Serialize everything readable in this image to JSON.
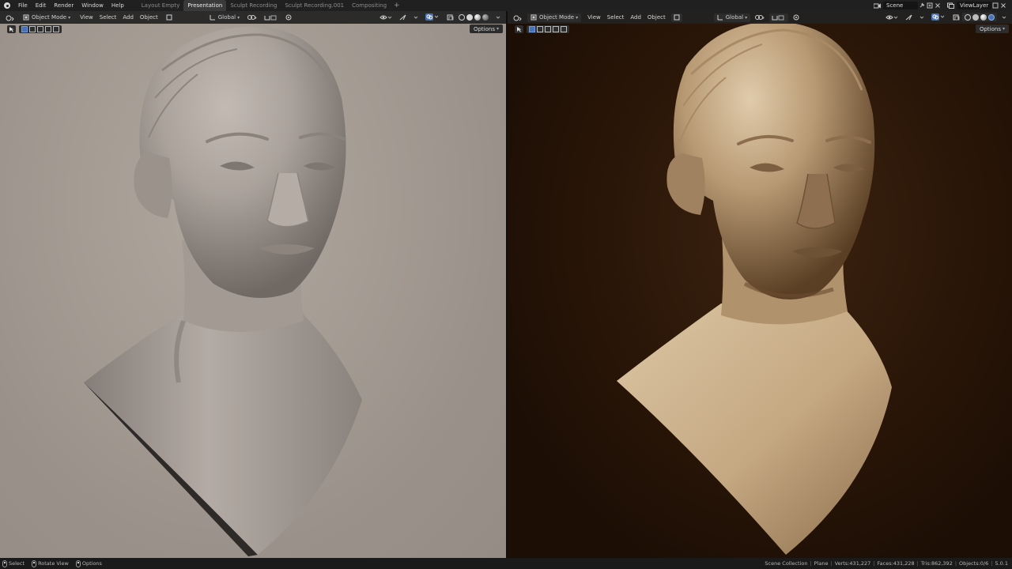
{
  "topbar": {
    "menu": [
      "File",
      "Edit",
      "Render",
      "Window",
      "Help"
    ],
    "workspaces": [
      {
        "label": "Layout Empty",
        "active": false
      },
      {
        "label": "Presentation",
        "active": true
      },
      {
        "label": "Sculpt Recording",
        "active": false
      },
      {
        "label": "Sculpt Recording.001",
        "active": false
      },
      {
        "label": "Compositing",
        "active": false
      }
    ],
    "add_workspace": "+",
    "scene": "Scene",
    "view_layer": "ViewLayer"
  },
  "viewport_left": {
    "mode": "Object Mode",
    "menu": [
      "View",
      "Select",
      "Add",
      "Object"
    ],
    "transform_orientation": "Global",
    "options_label": "Options",
    "colors": {
      "background": "#9a918a",
      "material": "#a8a09a"
    }
  },
  "viewport_right": {
    "mode": "Object Mode",
    "menu": [
      "View",
      "Select",
      "Add",
      "Object"
    ],
    "transform_orientation": "Global",
    "options_label": "Options",
    "colors": {
      "background": "#1c0e05",
      "material": "#c4a882"
    }
  },
  "statusbar": {
    "hints": [
      "Select",
      "Rotate View",
      "Options"
    ],
    "collection": "Scene Collection",
    "object": "Plane",
    "verts": "Verts:431,227",
    "faces": "Faces:431,228",
    "tris": "Tris:862,392",
    "objects": "Objects:0/6",
    "version": "5.0.1"
  }
}
